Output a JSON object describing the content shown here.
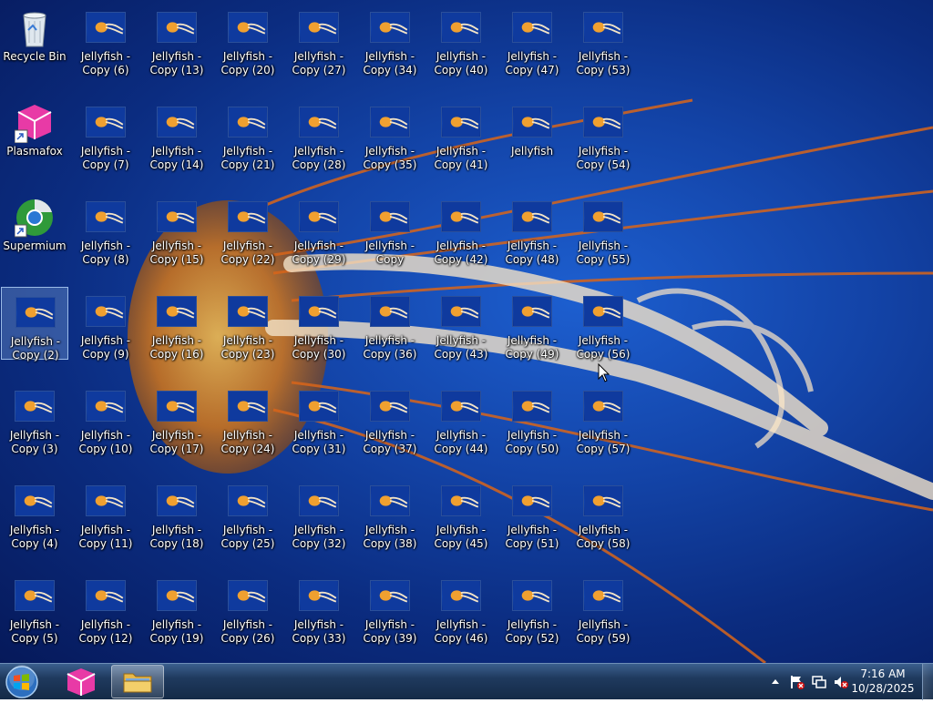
{
  "desktop": {
    "icons": [
      {
        "label": "Recycle Bin",
        "type": "recycle",
        "selected": false
      },
      {
        "label": "Plasmafox",
        "type": "plasmafox",
        "selected": false
      },
      {
        "label": "Supermium",
        "type": "supermium",
        "selected": false
      },
      {
        "label": "Jellyfish - Copy (2)",
        "type": "jelly",
        "selected": true
      },
      {
        "label": "Jellyfish - Copy (3)",
        "type": "jelly",
        "selected": false
      },
      {
        "label": "Jellyfish - Copy (4)",
        "type": "jelly",
        "selected": false
      },
      {
        "label": "Jellyfish - Copy (5)",
        "type": "jelly",
        "selected": false
      },
      {
        "label": "Jellyfish - Copy (6)",
        "type": "jelly",
        "selected": false
      },
      {
        "label": "Jellyfish - Copy (7)",
        "type": "jelly",
        "selected": false
      },
      {
        "label": "Jellyfish - Copy (8)",
        "type": "jelly",
        "selected": false
      },
      {
        "label": "Jellyfish - Copy (9)",
        "type": "jelly",
        "selected": false
      },
      {
        "label": "Jellyfish - Copy (10)",
        "type": "jelly",
        "selected": false
      },
      {
        "label": "Jellyfish - Copy (11)",
        "type": "jelly",
        "selected": false
      },
      {
        "label": "Jellyfish - Copy (12)",
        "type": "jelly",
        "selected": false
      },
      {
        "label": "Jellyfish - Copy (13)",
        "type": "jelly",
        "selected": false
      },
      {
        "label": "Jellyfish - Copy (14)",
        "type": "jelly",
        "selected": false
      },
      {
        "label": "Jellyfish - Copy (15)",
        "type": "jelly",
        "selected": false
      },
      {
        "label": "Jellyfish - Copy (16)",
        "type": "jelly",
        "selected": false
      },
      {
        "label": "Jellyfish - Copy (17)",
        "type": "jelly",
        "selected": false
      },
      {
        "label": "Jellyfish - Copy (18)",
        "type": "jelly",
        "selected": false
      },
      {
        "label": "Jellyfish - Copy (19)",
        "type": "jelly",
        "selected": false
      },
      {
        "label": "Jellyfish - Copy (20)",
        "type": "jelly",
        "selected": false
      },
      {
        "label": "Jellyfish - Copy (21)",
        "type": "jelly",
        "selected": false
      },
      {
        "label": "Jellyfish - Copy (22)",
        "type": "jelly",
        "selected": false
      },
      {
        "label": "Jellyfish - Copy (23)",
        "type": "jelly",
        "selected": false
      },
      {
        "label": "Jellyfish - Copy (24)",
        "type": "jelly",
        "selected": false
      },
      {
        "label": "Jellyfish - Copy (25)",
        "type": "jelly",
        "selected": false
      },
      {
        "label": "Jellyfish - Copy (26)",
        "type": "jelly",
        "selected": false
      },
      {
        "label": "Jellyfish - Copy (27)",
        "type": "jelly",
        "selected": false
      },
      {
        "label": "Jellyfish - Copy (28)",
        "type": "jelly",
        "selected": false
      },
      {
        "label": "Jellyfish - Copy (29)",
        "type": "jelly",
        "selected": false
      },
      {
        "label": "Jellyfish - Copy (30)",
        "type": "jelly",
        "selected": false
      },
      {
        "label": "Jellyfish - Copy (31)",
        "type": "jelly",
        "selected": false
      },
      {
        "label": "Jellyfish - Copy (32)",
        "type": "jelly",
        "selected": false
      },
      {
        "label": "Jellyfish - Copy (33)",
        "type": "jelly",
        "selected": false
      },
      {
        "label": "Jellyfish - Copy (34)",
        "type": "jelly",
        "selected": false
      },
      {
        "label": "Jellyfish - Copy (35)",
        "type": "jelly",
        "selected": false
      },
      {
        "label": "Jellyfish - Copy",
        "type": "jelly",
        "selected": false
      },
      {
        "label": "Jellyfish - Copy (36)",
        "type": "jelly",
        "selected": false
      },
      {
        "label": "Jellyfish - Copy (37)",
        "type": "jelly",
        "selected": false
      },
      {
        "label": "Jellyfish - Copy (38)",
        "type": "jelly",
        "selected": false
      },
      {
        "label": "Jellyfish - Copy (39)",
        "type": "jelly",
        "selected": false
      },
      {
        "label": "Jellyfish - Copy (40)",
        "type": "jelly",
        "selected": false
      },
      {
        "label": "Jellyfish - Copy (41)",
        "type": "jelly",
        "selected": false
      },
      {
        "label": "Jellyfish - Copy (42)",
        "type": "jelly",
        "selected": false
      },
      {
        "label": "Jellyfish - Copy (43)",
        "type": "jelly",
        "selected": false
      },
      {
        "label": "Jellyfish - Copy (44)",
        "type": "jelly",
        "selected": false
      },
      {
        "label": "Jellyfish - Copy (45)",
        "type": "jelly",
        "selected": false
      },
      {
        "label": "Jellyfish - Copy (46)",
        "type": "jelly",
        "selected": false
      },
      {
        "label": "Jellyfish - Copy (47)",
        "type": "jelly",
        "selected": false
      },
      {
        "label": "Jellyfish",
        "type": "jelly",
        "selected": false
      },
      {
        "label": "Jellyfish - Copy (48)",
        "type": "jelly",
        "selected": false
      },
      {
        "label": "Jellyfish - Copy (49)",
        "type": "jelly",
        "selected": false
      },
      {
        "label": "Jellyfish - Copy (50)",
        "type": "jelly",
        "selected": false
      },
      {
        "label": "Jellyfish - Copy (51)",
        "type": "jelly",
        "selected": false
      },
      {
        "label": "Jellyfish - Copy (52)",
        "type": "jelly",
        "selected": false
      },
      {
        "label": "Jellyfish - Copy (53)",
        "type": "jelly",
        "selected": false
      },
      {
        "label": "Jellyfish - Copy (54)",
        "type": "jelly",
        "selected": false
      },
      {
        "label": "Jellyfish - Copy (55)",
        "type": "jelly",
        "selected": false
      },
      {
        "label": "Jellyfish - Copy (56)",
        "type": "jelly",
        "selected": false
      },
      {
        "label": "Jellyfish - Copy (57)",
        "type": "jelly",
        "selected": false
      },
      {
        "label": "Jellyfish - Copy (58)",
        "type": "jelly",
        "selected": false
      },
      {
        "label": "Jellyfish - Copy (59)",
        "type": "jelly",
        "selected": false
      }
    ]
  },
  "taskbar": {
    "start_icon": "windows-orb-icon",
    "pinned": [
      {
        "name": "plasmafox-taskbar-button",
        "icon": "plasmafox-icon",
        "active": false
      },
      {
        "name": "file-explorer-taskbar-button",
        "icon": "folder-icon",
        "active": true
      }
    ],
    "tray": {
      "icons": [
        "show-hidden-icons-arrow",
        "action-center-flag-icon",
        "network-icon",
        "volume-muted-icon"
      ],
      "time": "7:16 AM",
      "date": "10/28/2025"
    }
  },
  "colors": {
    "desktop_blue": "#1344a8",
    "taskbar": "#1f3a5e",
    "selection": "#96bef0"
  }
}
